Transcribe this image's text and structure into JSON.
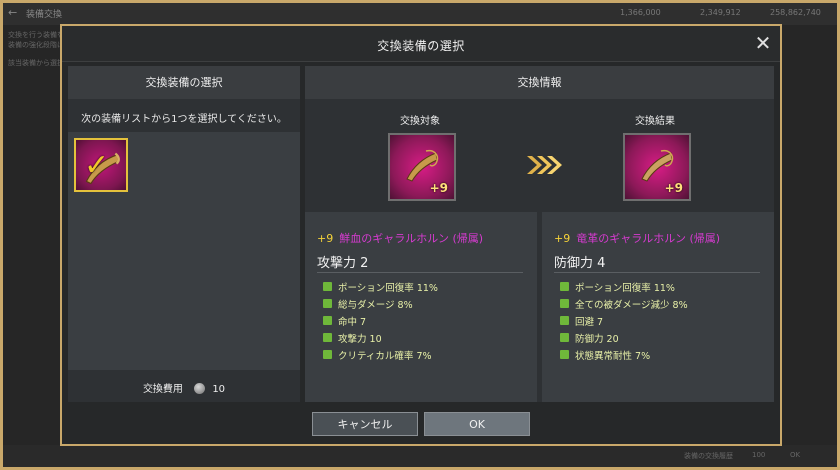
{
  "background": {
    "title": "装備交換",
    "stats": [
      "1,366,000",
      "2,349,912",
      "258,862,740"
    ],
    "side_lines": [
      "交換を行う装備を選択",
      "装備の強化段階は維持",
      "該当装備から選択"
    ],
    "bottom": [
      "装備の交換履歴",
      "100",
      "OK"
    ]
  },
  "modal": {
    "title": "交換装備の選択",
    "close_icon": "close-icon"
  },
  "left": {
    "header": "交換装備の選択",
    "instruction": "次の装備リストから1つを選択してください。",
    "cost_label": "交換費用",
    "cost_value": "10"
  },
  "right": {
    "header": "交換情報",
    "source_label": "交換対象",
    "result_label": "交換結果",
    "source_plus": "+9",
    "result_plus": "+9",
    "source": {
      "level": "+9",
      "name": "鮮血のギャラルホルン (帰属)",
      "main_stat": "攻撃力 2",
      "stats": [
        "ポーション回復率 11%",
        "総与ダメージ 8%",
        "命中 7",
        "攻撃力 10",
        "クリティカル確率 7%"
      ]
    },
    "result": {
      "level": "+9",
      "name": "竜革のギャラルホルン (帰属)",
      "main_stat": "防御力 4",
      "stats": [
        "ポーション回復率 11%",
        "全ての被ダメージ減少 8%",
        "回避 7",
        "防御力 20",
        "状態異常耐性 7%"
      ]
    }
  },
  "footer": {
    "cancel": "キャンセル",
    "ok": "OK"
  },
  "colors": {
    "frame_gold": "#c9a86a",
    "item_name": "#d63bd0",
    "level": "#f5d33a",
    "stat_text": "#e8f0a8"
  }
}
